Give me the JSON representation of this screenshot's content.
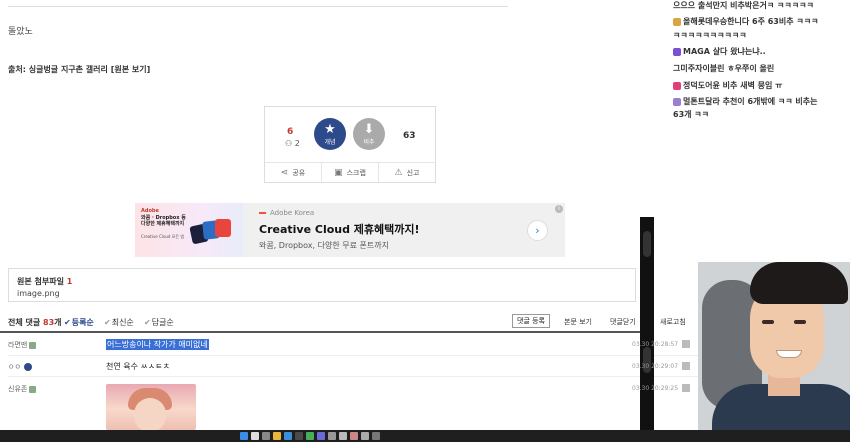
{
  "post": {
    "body_text": "돌았노",
    "source_prefix": "출처:",
    "source_gallery": "싱글벙글 지구촌 갤러리",
    "source_link": "[원본 보기]"
  },
  "vote": {
    "up_count": "6",
    "up_sub": "2",
    "up_label": "개념",
    "down_label": "비추",
    "down_count": "63",
    "actions": [
      {
        "label": "공유",
        "icon": "share-icon"
      },
      {
        "label": "스크랩",
        "icon": "scrap-icon"
      },
      {
        "label": "신고",
        "icon": "report-icon"
      }
    ]
  },
  "ad": {
    "left_brand": "Adobe",
    "left_line1": "와콤 · Dropbox 등 다양한 제휴혜택까지",
    "left_line2": "Creative Cloud 모든 앱",
    "source": "Adobe Korea",
    "title": "Creative Cloud 제휴혜택까지!",
    "desc": "와콤, Dropbox, 다양한 무료 폰트까지",
    "arrow": "›",
    "info": "i"
  },
  "attachment": {
    "heading": "원본 첨부파일",
    "count": "1",
    "filename": "image.png"
  },
  "comments_bar": {
    "all_label": "전체 댓글",
    "count": "83",
    "count_suffix": "개",
    "sorts": [
      "등록순",
      "최신순",
      "답글순"
    ],
    "register_button": "댓글 등록",
    "view_post": "본문 보기",
    "close_comments": "댓글닫기",
    "refresh": "새로고침"
  },
  "comments": [
    {
      "nick": "라면맨",
      "msg": "어느방송이나 작가가 애미없네",
      "time": "03.30 20:28:57",
      "selected": true
    },
    {
      "nick": "ㅇㅇ",
      "msg": "천연 육수 ㅆㅅㅌㅊ",
      "time": "03.30 20:29:07",
      "selected": false
    },
    {
      "nick": "신유존",
      "msg": "",
      "time": "03.30 20:29:25",
      "selected": false
    }
  ],
  "chat": [
    "으으으 출석만지 비추박은거ㅋ ㅋㅋㅋㅋㅋ",
    "올해롯데우승한니다 6주 63비추 ㅋㅋㅋ",
    "ㅋㅋㅋㅋㅋㅋㅋㅋㅋㅋ",
    "MAGA 살다 왔냐는냐..",
    "그미주자이블린 ㅎ우쭈이 올린",
    "정덕도어윤 비추 새벽 뭉임 ㅠ",
    "멀톤트달라 추천이 6개밖에 ㅋㅋ 비추는",
    "63개 ㅋㅋ"
  ],
  "colors": {
    "accent_red": "#c0392b",
    "vote_blue": "#2d4a8a",
    "selection": "#3a6fd8"
  }
}
